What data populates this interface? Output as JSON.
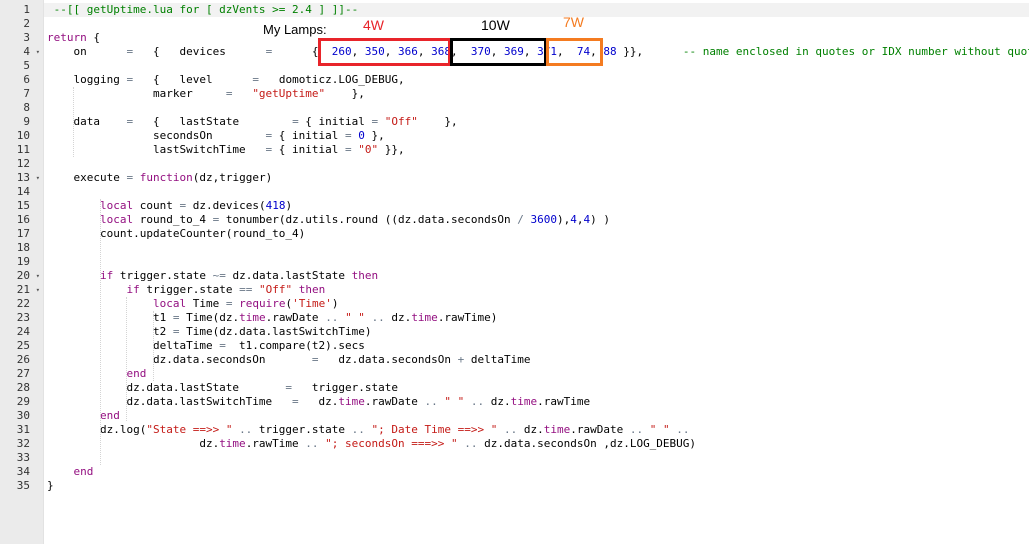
{
  "editor": {
    "line_numbers": [
      "1",
      "2",
      "3",
      "4",
      "5",
      "6",
      "7",
      "8",
      "9",
      "10",
      "11",
      "12",
      "13",
      "14",
      "15",
      "16",
      "17",
      "18",
      "19",
      "20",
      "21",
      "22",
      "23",
      "24",
      "25",
      "26",
      "27",
      "28",
      "29",
      "30",
      "31",
      "32",
      "33",
      "34",
      "35"
    ],
    "fold_markers": {
      "4": "▾",
      "13": "▾",
      "20": "▾",
      "21": "▾"
    },
    "lines": [
      [
        {
          "t": " --[[ getUptime.lua for [ dzVents >= 2.4 ] ]]--",
          "c": "com"
        }
      ],
      [],
      [
        {
          "t": "return",
          "c": "kw"
        },
        {
          "t": " {"
        }
      ],
      [
        {
          "t": "    on      "
        },
        {
          "t": "=",
          "c": "op"
        },
        {
          "t": "   {   devices      "
        },
        {
          "t": "=",
          "c": "op"
        },
        {
          "t": "      {  "
        },
        {
          "t": "260",
          "c": "num"
        },
        {
          "t": ", "
        },
        {
          "t": "350",
          "c": "num"
        },
        {
          "t": ", "
        },
        {
          "t": "366",
          "c": "num"
        },
        {
          "t": ", "
        },
        {
          "t": "368",
          "c": "num"
        },
        {
          "t": ",  "
        },
        {
          "t": "370",
          "c": "num"
        },
        {
          "t": ", "
        },
        {
          "t": "369",
          "c": "num"
        },
        {
          "t": ", "
        },
        {
          "t": "371",
          "c": "num"
        },
        {
          "t": ",  "
        },
        {
          "t": "74",
          "c": "num"
        },
        {
          "t": ", "
        },
        {
          "t": "88",
          "c": "num"
        },
        {
          "t": " }},      "
        },
        {
          "t": "-- name enclosed in quotes or IDX number without quotes",
          "c": "com"
        }
      ],
      [],
      [
        {
          "t": "    logging "
        },
        {
          "t": "=",
          "c": "op"
        },
        {
          "t": "   {   level      "
        },
        {
          "t": "=",
          "c": "op"
        },
        {
          "t": "   domoticz.LOG_DEBUG,"
        }
      ],
      [
        {
          "t": "                marker     "
        },
        {
          "t": "=",
          "c": "op"
        },
        {
          "t": "   "
        },
        {
          "t": "\"getUptime\"",
          "c": "str"
        },
        {
          "t": "    },"
        }
      ],
      [],
      [
        {
          "t": "    data    "
        },
        {
          "t": "=",
          "c": "op"
        },
        {
          "t": "   {   lastState        "
        },
        {
          "t": "=",
          "c": "op"
        },
        {
          "t": " { initial "
        },
        {
          "t": "=",
          "c": "op"
        },
        {
          "t": " "
        },
        {
          "t": "\"Off\"",
          "c": "str"
        },
        {
          "t": "    },"
        }
      ],
      [
        {
          "t": "                secondsOn        "
        },
        {
          "t": "=",
          "c": "op"
        },
        {
          "t": " { initial "
        },
        {
          "t": "=",
          "c": "op"
        },
        {
          "t": " "
        },
        {
          "t": "0",
          "c": "num"
        },
        {
          "t": " },"
        }
      ],
      [
        {
          "t": "                lastSwitchTime   "
        },
        {
          "t": "=",
          "c": "op"
        },
        {
          "t": " { initial "
        },
        {
          "t": "=",
          "c": "op"
        },
        {
          "t": " "
        },
        {
          "t": "\"0\"",
          "c": "str"
        },
        {
          "t": " }},"
        }
      ],
      [],
      [
        {
          "t": "    execute "
        },
        {
          "t": "=",
          "c": "op"
        },
        {
          "t": " "
        },
        {
          "t": "function",
          "c": "kw"
        },
        {
          "t": "(dz,trigger)"
        }
      ],
      [],
      [
        {
          "t": "        "
        },
        {
          "t": "local",
          "c": "kw"
        },
        {
          "t": " count "
        },
        {
          "t": "=",
          "c": "op"
        },
        {
          "t": " dz.devices("
        },
        {
          "t": "418",
          "c": "num"
        },
        {
          "t": ")"
        }
      ],
      [
        {
          "t": "        "
        },
        {
          "t": "local",
          "c": "kw"
        },
        {
          "t": " round_to_4 "
        },
        {
          "t": "=",
          "c": "op"
        },
        {
          "t": " tonumber(dz.utils.round ((dz.data.secondsOn "
        },
        {
          "t": "/",
          "c": "op"
        },
        {
          "t": " "
        },
        {
          "t": "3600",
          "c": "num"
        },
        {
          "t": "),"
        },
        {
          "t": "4",
          "c": "num"
        },
        {
          "t": ","
        },
        {
          "t": "4",
          "c": "num"
        },
        {
          "t": ") )"
        }
      ],
      [
        {
          "t": "        count.updateCounter(round_to_4)"
        }
      ],
      [],
      [],
      [
        {
          "t": "        "
        },
        {
          "t": "if",
          "c": "kw"
        },
        {
          "t": " trigger.state "
        },
        {
          "t": "~=",
          "c": "op"
        },
        {
          "t": " dz.data.lastState "
        },
        {
          "t": "then",
          "c": "kw"
        }
      ],
      [
        {
          "t": "            "
        },
        {
          "t": "if",
          "c": "kw"
        },
        {
          "t": " trigger.state "
        },
        {
          "t": "==",
          "c": "op"
        },
        {
          "t": " "
        },
        {
          "t": "\"Off\"",
          "c": "str"
        },
        {
          "t": " "
        },
        {
          "t": "then",
          "c": "kw"
        }
      ],
      [
        {
          "t": "                "
        },
        {
          "t": "local",
          "c": "kw"
        },
        {
          "t": " Time "
        },
        {
          "t": "=",
          "c": "op"
        },
        {
          "t": " "
        },
        {
          "t": "require",
          "c": "kw"
        },
        {
          "t": "("
        },
        {
          "t": "'Time'",
          "c": "str"
        },
        {
          "t": ")"
        }
      ],
      [
        {
          "t": "                t1 "
        },
        {
          "t": "=",
          "c": "op"
        },
        {
          "t": " Time(dz."
        },
        {
          "t": "time",
          "c": "kw"
        },
        {
          "t": ".rawDate "
        },
        {
          "t": "..",
          "c": "op"
        },
        {
          "t": " "
        },
        {
          "t": "\" \"",
          "c": "str"
        },
        {
          "t": " "
        },
        {
          "t": "..",
          "c": "op"
        },
        {
          "t": " dz."
        },
        {
          "t": "time",
          "c": "kw"
        },
        {
          "t": ".rawTime)"
        }
      ],
      [
        {
          "t": "                t2 "
        },
        {
          "t": "=",
          "c": "op"
        },
        {
          "t": " Time(dz.data.lastSwitchTime)"
        }
      ],
      [
        {
          "t": "                deltaTime "
        },
        {
          "t": "=",
          "c": "op"
        },
        {
          "t": "  t1.compare(t2).secs"
        }
      ],
      [
        {
          "t": "                dz.data.secondsOn       "
        },
        {
          "t": "=",
          "c": "op"
        },
        {
          "t": "   dz.data.secondsOn "
        },
        {
          "t": "+",
          "c": "op"
        },
        {
          "t": " deltaTime"
        }
      ],
      [
        {
          "t": "            "
        },
        {
          "t": "end",
          "c": "kw"
        }
      ],
      [
        {
          "t": "            dz.data.lastState       "
        },
        {
          "t": "=",
          "c": "op"
        },
        {
          "t": "   trigger.state"
        }
      ],
      [
        {
          "t": "            dz.data.lastSwitchTime   "
        },
        {
          "t": "=",
          "c": "op"
        },
        {
          "t": "   dz."
        },
        {
          "t": "time",
          "c": "kw"
        },
        {
          "t": ".rawDate "
        },
        {
          "t": "..",
          "c": "op"
        },
        {
          "t": " "
        },
        {
          "t": "\" \"",
          "c": "str"
        },
        {
          "t": " "
        },
        {
          "t": "..",
          "c": "op"
        },
        {
          "t": " dz."
        },
        {
          "t": "time",
          "c": "kw"
        },
        {
          "t": ".rawTime"
        }
      ],
      [
        {
          "t": "        "
        },
        {
          "t": "end",
          "c": "kw"
        }
      ],
      [
        {
          "t": "        dz.log("
        },
        {
          "t": "\"State ==>> \"",
          "c": "str"
        },
        {
          "t": " "
        },
        {
          "t": "..",
          "c": "op"
        },
        {
          "t": " trigger.state "
        },
        {
          "t": "..",
          "c": "op"
        },
        {
          "t": " "
        },
        {
          "t": "\"; Date Time ==>> \"",
          "c": "str"
        },
        {
          "t": " "
        },
        {
          "t": "..",
          "c": "op"
        },
        {
          "t": " dz."
        },
        {
          "t": "time",
          "c": "kw"
        },
        {
          "t": ".rawDate "
        },
        {
          "t": "..",
          "c": "op"
        },
        {
          "t": " "
        },
        {
          "t": "\" \"",
          "c": "str"
        },
        {
          "t": " "
        },
        {
          "t": "..",
          "c": "op"
        }
      ],
      [
        {
          "t": "                       dz."
        },
        {
          "t": "time",
          "c": "kw"
        },
        {
          "t": ".rawTime "
        },
        {
          "t": "..",
          "c": "op"
        },
        {
          "t": " "
        },
        {
          "t": "\"; secondsOn ===>> \"",
          "c": "str"
        },
        {
          "t": " "
        },
        {
          "t": "..",
          "c": "op"
        },
        {
          "t": " dz.data.secondsOn ,dz.LOG_DEBUG)"
        }
      ],
      [],
      [
        {
          "t": "    "
        },
        {
          "t": "end",
          "c": "kw"
        }
      ],
      [
        {
          "t": "}"
        }
      ]
    ]
  },
  "annotations": {
    "my_lamps": "My Lamps:",
    "label_4w": "4W",
    "label_10w": "10W",
    "label_7w": "7W",
    "color_4w": "#e8242a",
    "color_10w": "#000000",
    "color_7w": "#f47b20"
  }
}
